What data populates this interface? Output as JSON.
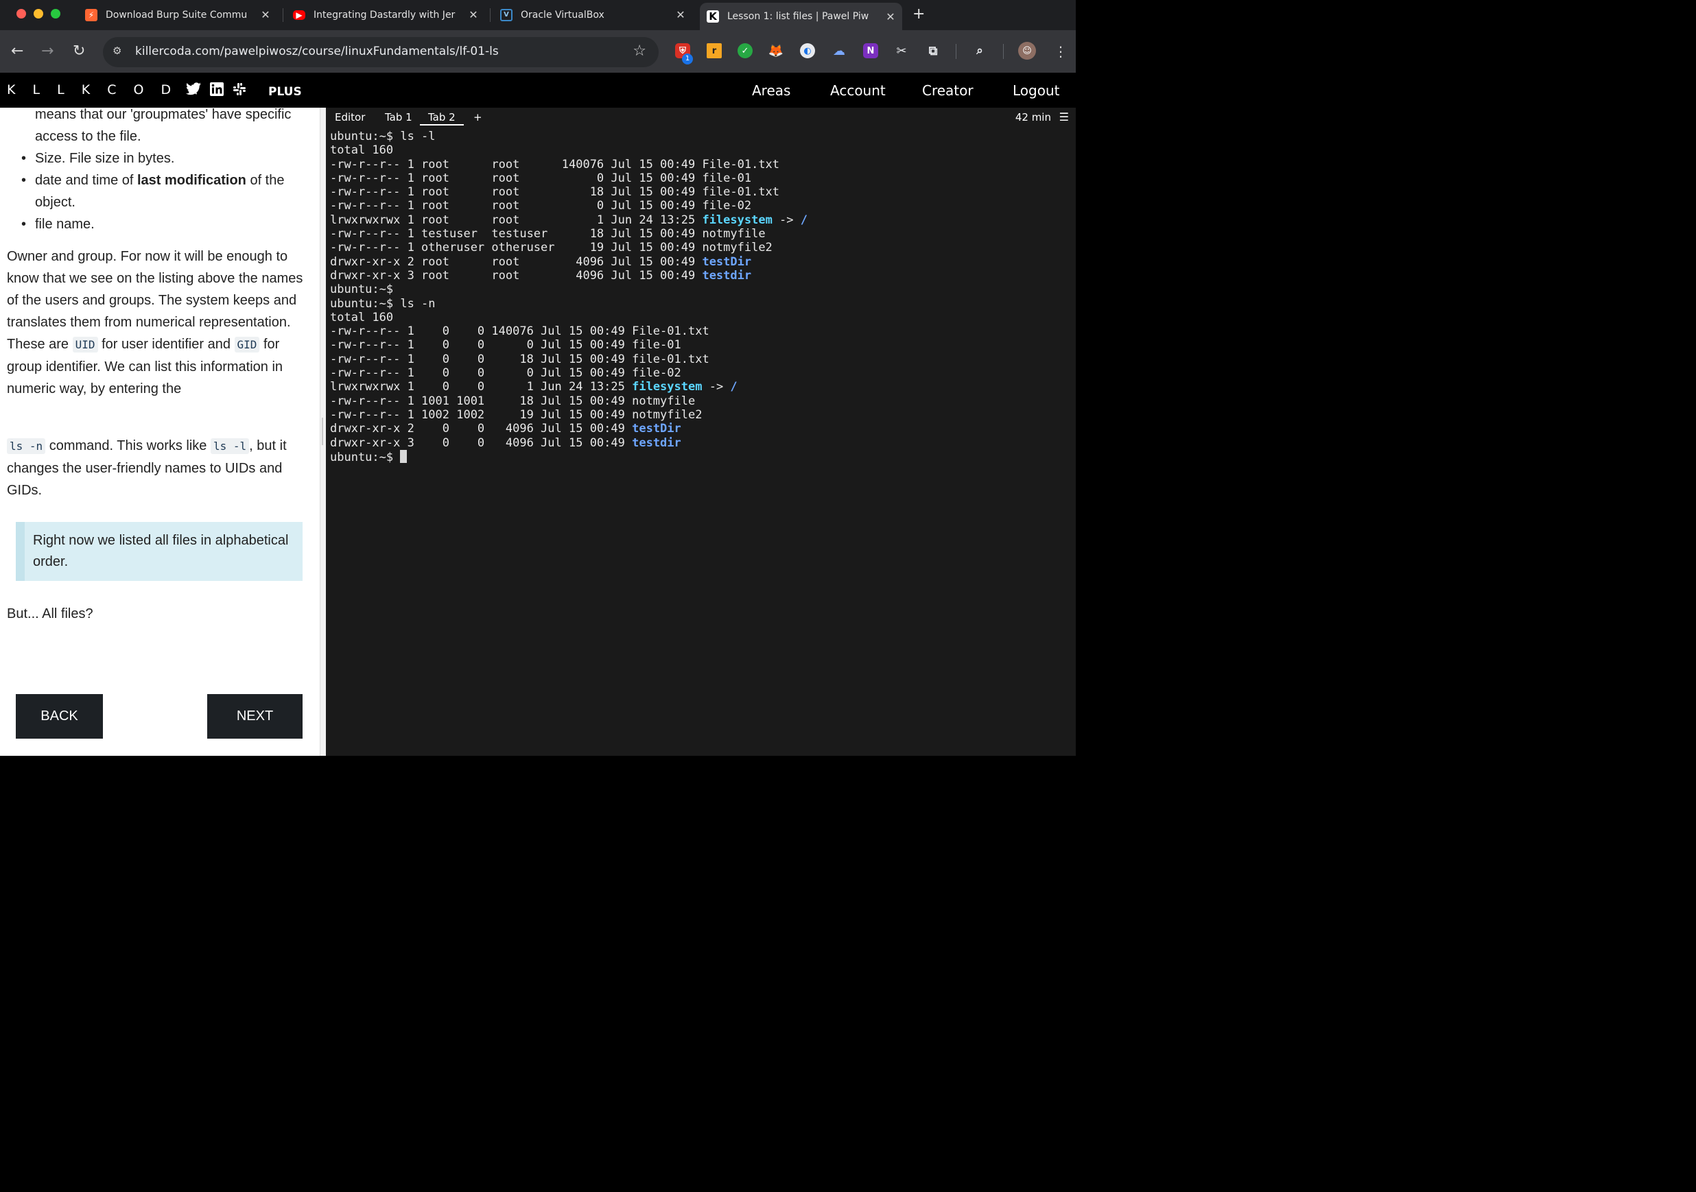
{
  "browser": {
    "tabs": [
      {
        "title": "Download Burp Suite Commu",
        "favicon": "burp-icon",
        "color": "#ff6633"
      },
      {
        "title": "Integrating Dastardly with Jer",
        "favicon": "youtube-icon",
        "color": "#ff0000"
      },
      {
        "title": "Oracle VirtualBox",
        "favicon": "virtualbox-icon",
        "color": "#1f6fb6"
      },
      {
        "title": "Lesson 1: list files | Pawel Piw",
        "favicon": "killercoda-icon",
        "color": "#ffffff"
      }
    ],
    "url": "killercoda.com/pawelpiwosz/course/linuxFundamentals/lf-01-ls",
    "extension_badge": "1"
  },
  "site": {
    "logo": "K L L K C O D Λ",
    "plus": "PLUS",
    "nav": [
      "Areas",
      "Account",
      "Creator",
      "Logout"
    ]
  },
  "lesson": {
    "bullet_top": "means that our 'groupmates' have specific",
    "bullet_top_cont": "access to the file.",
    "bullet_size": "Size. File size in bytes.",
    "bullet_date_pre": "date and time of ",
    "bullet_date_bold": "last modification",
    "bullet_date_post": " of the",
    "bullet_date_cont": "object.",
    "bullet_name": "file name.",
    "p1_a": "Owner and group. For now it will be enough to know that we see on the listing above the names of the users and groups. The system keeps and translates them from numerical representation. These are ",
    "p1_code1": "UID",
    "p1_b": " for user identifier and ",
    "p1_code2": "GID",
    "p1_c": " for group identifier. We can list this information in numeric way, by entering the",
    "p2_code1": "ls -n",
    "p2_a": " command. This works like ",
    "p2_code2": "ls -l",
    "p2_b": ", but it changes the user-friendly names to UIDs and GIDs.",
    "callout": "Right now we listed all files in alphabetical order.",
    "p3": "But... All files?",
    "back": "BACK",
    "next": "NEXT"
  },
  "terminal": {
    "tabs": [
      "Editor",
      "Tab 1",
      "Tab 2",
      "+"
    ],
    "active_tab": "Tab 2",
    "timer": "42 min",
    "lines": [
      [
        {
          "t": "ubuntu:~$ ls -l"
        }
      ],
      [
        {
          "t": "total 160"
        }
      ],
      [
        {
          "t": "-rw-r--r-- 1 root      root      140076 Jul 15 00:49 File-01.txt"
        }
      ],
      [
        {
          "t": "-rw-r--r-- 1 root      root           0 Jul 15 00:49 file-01"
        }
      ],
      [
        {
          "t": "-rw-r--r-- 1 root      root          18 Jul 15 00:49 file-01.txt"
        }
      ],
      [
        {
          "t": "-rw-r--r-- 1 root      root           0 Jul 15 00:49 file-02"
        }
      ],
      [
        {
          "t": "lrwxrwxrwx 1 root      root           1 Jun 24 13:25 "
        },
        {
          "t": "filesystem",
          "c": "cy"
        },
        {
          "t": " -> "
        },
        {
          "t": "/",
          "c": "bl"
        }
      ],
      [
        {
          "t": "-rw-r--r-- 1 testuser  testuser      18 Jul 15 00:49 notmyfile"
        }
      ],
      [
        {
          "t": "-rw-r--r-- 1 otheruser otheruser     19 Jul 15 00:49 notmyfile2"
        }
      ],
      [
        {
          "t": "drwxr-xr-x 2 root      root        4096 Jul 15 00:49 "
        },
        {
          "t": "testDir",
          "c": "bl"
        }
      ],
      [
        {
          "t": "drwxr-xr-x 3 root      root        4096 Jul 15 00:49 "
        },
        {
          "t": "testdir",
          "c": "bl"
        }
      ],
      [
        {
          "t": "ubuntu:~$"
        }
      ],
      [
        {
          "t": "ubuntu:~$ ls -n"
        }
      ],
      [
        {
          "t": "total 160"
        }
      ],
      [
        {
          "t": "-rw-r--r-- 1    0    0 140076 Jul 15 00:49 File-01.txt"
        }
      ],
      [
        {
          "t": "-rw-r--r-- 1    0    0      0 Jul 15 00:49 file-01"
        }
      ],
      [
        {
          "t": "-rw-r--r-- 1    0    0     18 Jul 15 00:49 file-01.txt"
        }
      ],
      [
        {
          "t": "-rw-r--r-- 1    0    0      0 Jul 15 00:49 file-02"
        }
      ],
      [
        {
          "t": "lrwxrwxrwx 1    0    0      1 Jun 24 13:25 "
        },
        {
          "t": "filesystem",
          "c": "cy"
        },
        {
          "t": " -> "
        },
        {
          "t": "/",
          "c": "bl"
        }
      ],
      [
        {
          "t": "-rw-r--r-- 1 1001 1001     18 Jul 15 00:49 notmyfile"
        }
      ],
      [
        {
          "t": "-rw-r--r-- 1 1002 1002     19 Jul 15 00:49 notmyfile2"
        }
      ],
      [
        {
          "t": "drwxr-xr-x 2    0    0   4096 Jul 15 00:49 "
        },
        {
          "t": "testDir",
          "c": "bl"
        }
      ],
      [
        {
          "t": "drwxr-xr-x 3    0    0   4096 Jul 15 00:49 "
        },
        {
          "t": "testdir",
          "c": "bl"
        }
      ],
      [
        {
          "t": "ubuntu:~$ "
        },
        {
          "t": "",
          "c": "cursor"
        }
      ]
    ]
  },
  "colors": {
    "terminal_bg": "#1a1a1a",
    "link_cyan": "#5bd6ff",
    "dir_blue": "#6ea6ff",
    "button_dark": "#1d2125",
    "callout_bg": "#d9eef4"
  }
}
